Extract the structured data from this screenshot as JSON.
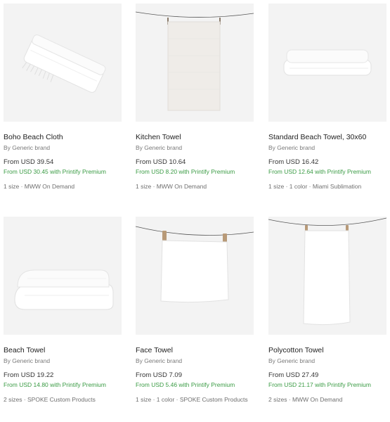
{
  "products": [
    {
      "name": "Boho Beach Cloth",
      "brand": "By Generic brand",
      "price": "From USD 39.54",
      "premium": "From USD 30.45 with Printify Premium",
      "meta": "1 size · MWW On Demand",
      "image": "folded-fringe-cloth"
    },
    {
      "name": "Kitchen Towel",
      "brand": "By Generic brand",
      "price": "From USD 10.64",
      "premium": "From USD 8.20 with Printify Premium",
      "meta": "1 size · MWW On Demand",
      "image": "hanging-towel"
    },
    {
      "name": "Standard Beach Towel, 30x60",
      "brand": "By Generic brand",
      "price": "From USD 16.42",
      "premium": "From USD 12.64 with Printify Premium",
      "meta": "1 size · 1 color · Miami Sublimation",
      "image": "folded-flat-towel"
    },
    {
      "name": "Beach Towel",
      "brand": "By Generic brand",
      "price": "From USD 19.22",
      "premium": "From USD 14.80 with Printify Premium",
      "meta": "2 sizes · SPOKE Custom Products",
      "image": "folded-stacked-towel"
    },
    {
      "name": "Face Towel",
      "brand": "By Generic brand",
      "price": "From USD 7.09",
      "premium": "From USD 5.46 with Printify Premium",
      "meta": "1 size · 1 color · SPOKE Custom Products",
      "image": "hanging-towel-pegs"
    },
    {
      "name": "Polycotton Towel",
      "brand": "By Generic brand",
      "price": "From USD 27.49",
      "premium": "From USD 21.17 with Printify Premium",
      "meta": "2 sizes · MWW On Demand",
      "image": "hanging-towel-pegs"
    }
  ],
  "colors": {
    "premium": "#3a9b44",
    "thumb_background": "#f3f3f3"
  }
}
